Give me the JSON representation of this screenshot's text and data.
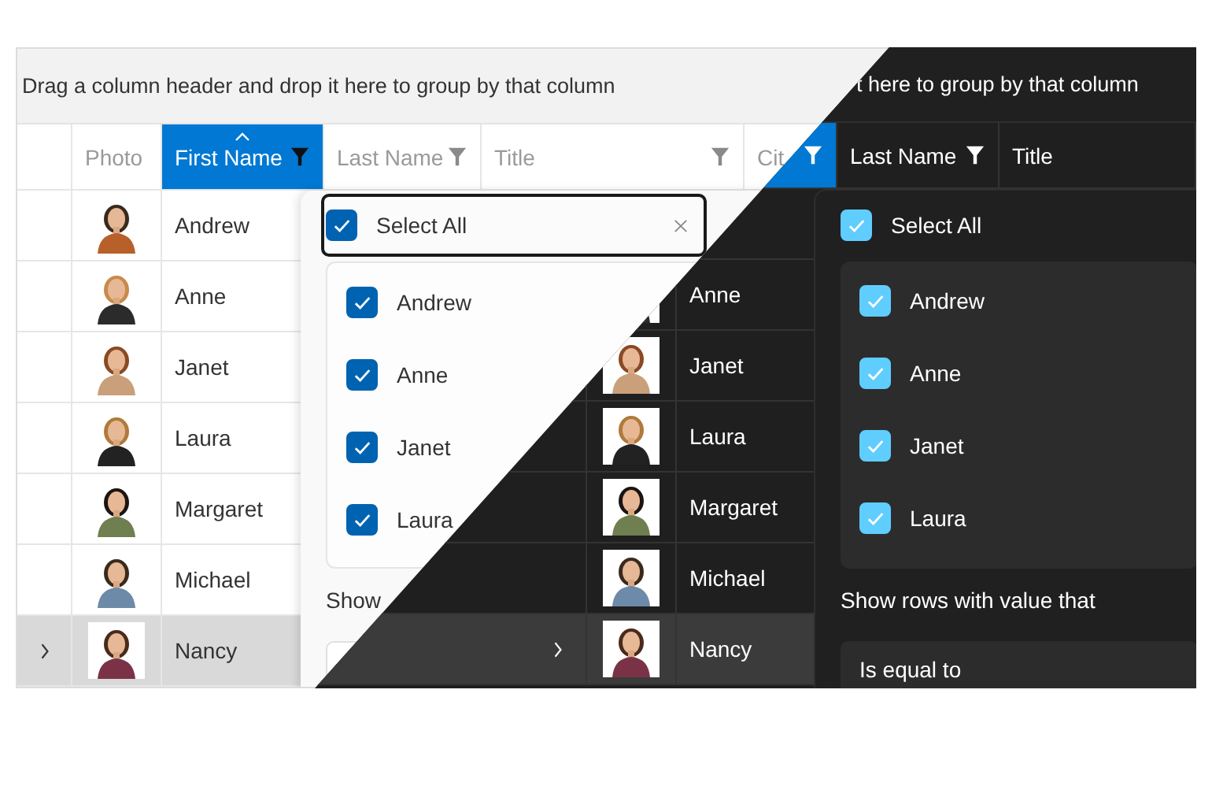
{
  "panels": [
    {
      "group_hint": "Drag a column header and drop it here to group by that column",
      "columns": [
        {
          "label": "Photo",
          "selected": false,
          "filter": false
        },
        {
          "label": "First Name",
          "selected": true,
          "filter": true,
          "sorted": true
        },
        {
          "label": "Last Name",
          "selected": false,
          "filter": true
        },
        {
          "label": "Title",
          "selected": false,
          "filter": true
        },
        {
          "label": "Cit",
          "selected": false,
          "filter": false
        }
      ],
      "rows": [
        {
          "first_name": "Andrew",
          "selected": false
        },
        {
          "first_name": "Anne",
          "selected": false
        },
        {
          "first_name": "Janet",
          "selected": false
        },
        {
          "first_name": "Laura",
          "selected": false
        },
        {
          "first_name": "Margaret",
          "selected": false
        },
        {
          "first_name": "Michael",
          "selected": false
        },
        {
          "first_name": "Nancy",
          "selected": true
        }
      ],
      "filter": {
        "select_all": {
          "label": "Select All",
          "checked": true,
          "focused": true
        },
        "items": [
          {
            "label": "Andrew",
            "checked": true
          },
          {
            "label": "Anne",
            "checked": true
          },
          {
            "label": "Janet",
            "checked": true
          },
          {
            "label": "Laura",
            "checked": true
          }
        ],
        "condition_label": "Show"
      }
    },
    {
      "group_hint": "t here to group by that column",
      "columns": [
        {},
        {
          "selected": true,
          "filter": true
        },
        {
          "label": "Last Name",
          "selected": false,
          "filter": true
        },
        {
          "label": "Title",
          "selected": false,
          "filter": false
        }
      ],
      "rows": [
        {},
        {
          "first_name": "Anne"
        },
        {
          "first_name": "Janet",
          "selected": false
        },
        {
          "first_name": "Laura",
          "selected": false
        },
        {
          "first_name": "Margaret",
          "selected": false
        },
        {
          "first_name": "Michael",
          "selected": false
        },
        {
          "first_name": "Nancy",
          "selected": true
        }
      ],
      "filter": {
        "select_all": {
          "label": "Select All",
          "checked": true,
          "focused": false
        },
        "items": [
          {
            "label": "Andrew",
            "checked": true
          },
          {
            "label": "Anne",
            "checked": true
          },
          {
            "label": "Janet",
            "checked": true
          },
          {
            "label": "Laura",
            "checked": true
          }
        ],
        "condition_label": "Show rows with value that",
        "operator": "Is equal to"
      }
    }
  ]
}
